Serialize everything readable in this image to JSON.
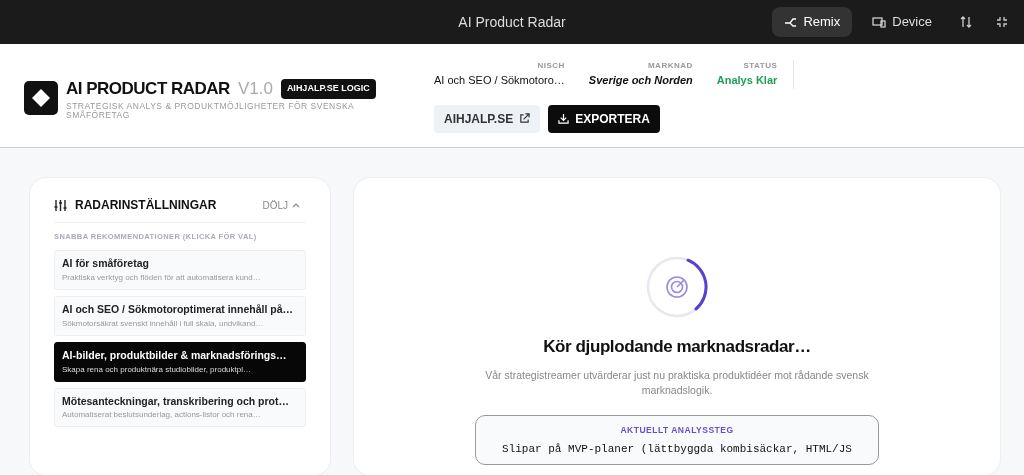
{
  "topbar": {
    "title": "AI Product Radar",
    "buttons": [
      {
        "label": "Remix",
        "kind": "remix",
        "selected": true
      },
      {
        "label": "Device",
        "kind": "device",
        "selected": false
      }
    ]
  },
  "header": {
    "app_name": "AI PRODUCT RADAR",
    "version": "V1.0",
    "badge": "AIHJALP.SE LOGIC",
    "subtitle": "STRATEGISK ANALYS & PRODUKTMÖJLIGHETER FÖR SVENSKA SMÅFÖRETAG",
    "stats": [
      {
        "label": "NISCH",
        "value": "AI och SEO / Sökmotoro…",
        "kind": "plain"
      },
      {
        "label": "MARKNAD",
        "value": "Sverige och Norden",
        "kind": "italic"
      },
      {
        "label": "STATUS",
        "value": "Analys Klar",
        "kind": "status"
      }
    ],
    "link_button": "AIHJALP.SE",
    "export_button": "EXPORTERA"
  },
  "settings": {
    "title": "RADARINSTÄLLNINGAR",
    "toggle": "DÖLJ",
    "expanded": true,
    "section_label": "SNABBA REKOMMENDATIONER (KLICKA FÖR VAL)",
    "recommendations": [
      {
        "title": "AI för småföretag",
        "description": "Praktiska verktyg och flöden för att automatisera kund…",
        "selected": false
      },
      {
        "title": "AI och SEO / Sökmotoroptimerat innehåll på…",
        "description": "Sökmotorsäkrat svenskt innehåll i full skala, undvikand…",
        "selected": false
      },
      {
        "title": "AI-bilder, produktbilder & marknadsförings…",
        "description": "Skapa rena och produktnära studiobilder, produktpl…",
        "selected": true
      },
      {
        "title": "Mötesanteckningar, transkribering och prot…",
        "description": "Automatiserat beslutsunderlag, actions-listor och rena…",
        "selected": false
      }
    ]
  },
  "main": {
    "heading": "Kör djuplodande marknadsradar…",
    "description": "Vår strategistreamer utvärderar just nu praktiska produktidéer mot rådande svensk marknadslogik.",
    "step_label": "AKTUELLT ANALYSSTEG",
    "step_text": "Slipar på MVP-planer (lättbyggda kombisäckar, HTML/JS"
  }
}
